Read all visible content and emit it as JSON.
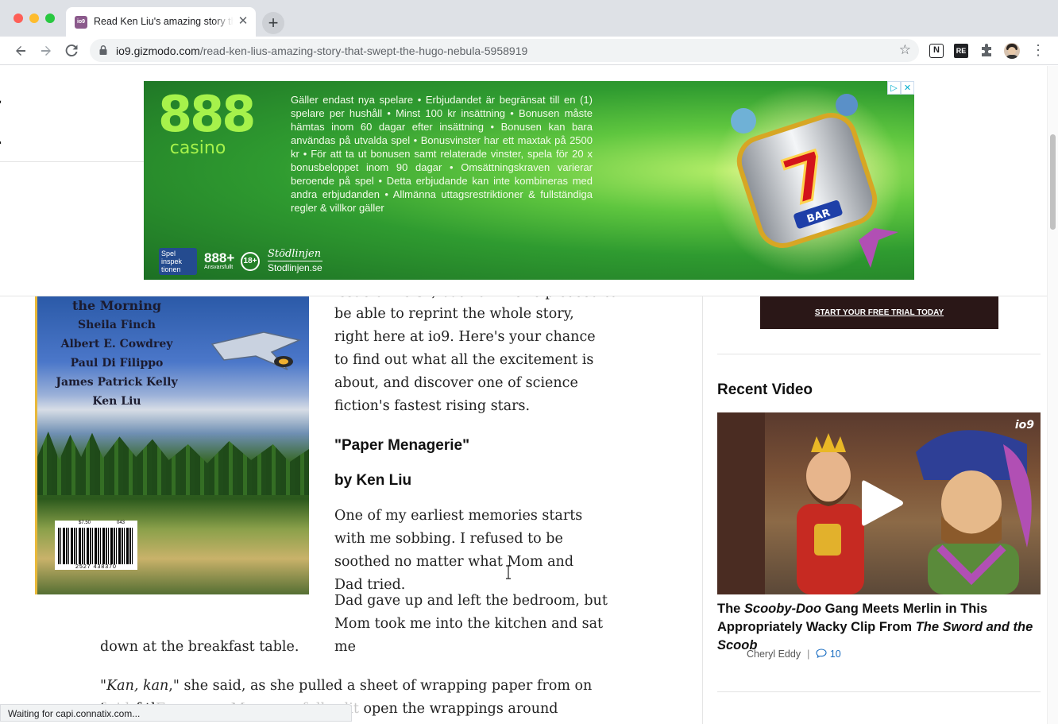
{
  "browser": {
    "tab_title": "Read Ken Liu's amazing story that swept the Hugo Nebula",
    "tab_favicon_text": "io9",
    "url_domain": "io9.gizmodo.com",
    "url_path": "/read-ken-lius-amazing-story-that-swept-the-hugo-nebula-5958919",
    "extensions": [
      "notion-icon",
      "reader-icon",
      "puzzle-icon"
    ],
    "status_text": "Waiting for capi.connatix.com..."
  },
  "ad": {
    "brand_number": "888",
    "brand_word": "casino",
    "copy": "Gäller endast nya spelare • Erbjudandet är begränsat till en (1) spelare per hushåll • Minst 100 kr insättning • Bonusen måste hämtas inom 60 dagar efter insättning • Bonusen kan bara användas på utvalda spel • Bonusvinster har ett maxtak på 2500 kr • För att ta ut bonusen samt relaterade vinster, spela för 20 x bonusbeloppet inom 90 dagar • Omsättningskraven varierar beroende på spel • Detta erbjudande kan inte kombineras med andra erbjudanden • Allmänna uttagsrestriktioner & fullständiga regler & villkor gäller",
    "spel_badge": "Spel inspek tionen",
    "ansvar_main": "888+",
    "ansvar_sub": "Ansvarsfullt",
    "age_label": "18+",
    "stodlinjen_script": "Stödlinjen",
    "stodlinjen_url": "Stodlinjen.se",
    "colors": {
      "brand_green": "#a6f24b",
      "bg_dark": "#1c6f24",
      "bg_light": "#b9f06b"
    }
  },
  "header": {
    "logo_fragment": "("
  },
  "article": {
    "cover_lines": [
      "the Morning",
      "Sheila Finch",
      "Albert E. Cowdrey",
      "Paul Di Filippo",
      "James Patrick Kelly",
      "Ken Liu"
    ],
    "barcode_price": "$7.50",
    "barcode_issue": "043",
    "barcode_number": "2527 438370",
    "cut_line": "issue of F&SF, but now we're pleased to",
    "para1": "be able to reprint the whole story, right here at io9. Here's your chance to find out what all the excitement is about, and discover one of science fiction's fastest rising stars.",
    "story_title": "\"Paper Menagerie\"",
    "byline": "by Ken Liu",
    "para2": "One of my earliest memories starts with me sobbing. I refused to be soothed no matter what Mom and Dad tried.",
    "para3a": "Dad gave up and left the bedroom, but Mom took me into the kitchen and sat me",
    "para3b": "down at the breakfast table.",
    "para4_open": "\"",
    "para4_italic": "Kan, kan",
    "para4_rest": ",\" she said, as she pulled a sheet of wrapping paper from on top of the",
    "para5_pre": "f ridge. For years, Mom carefully slit",
    "para5_rest": "open the wrappings around Christmas"
  },
  "sidebar": {
    "promo_link": "START YOUR FREE TRIAL TODAY",
    "recent_title": "Recent Video",
    "video_badge": "io9",
    "headline_pre": "The ",
    "headline_em1": "Scooby-Doo",
    "headline_mid": " Gang Meets Merlin in This Appropriately Wacky Clip From ",
    "headline_em2": "The Sword and the Scoob",
    "author": "Cheryl Eddy",
    "separator": "|",
    "comments": "10"
  }
}
